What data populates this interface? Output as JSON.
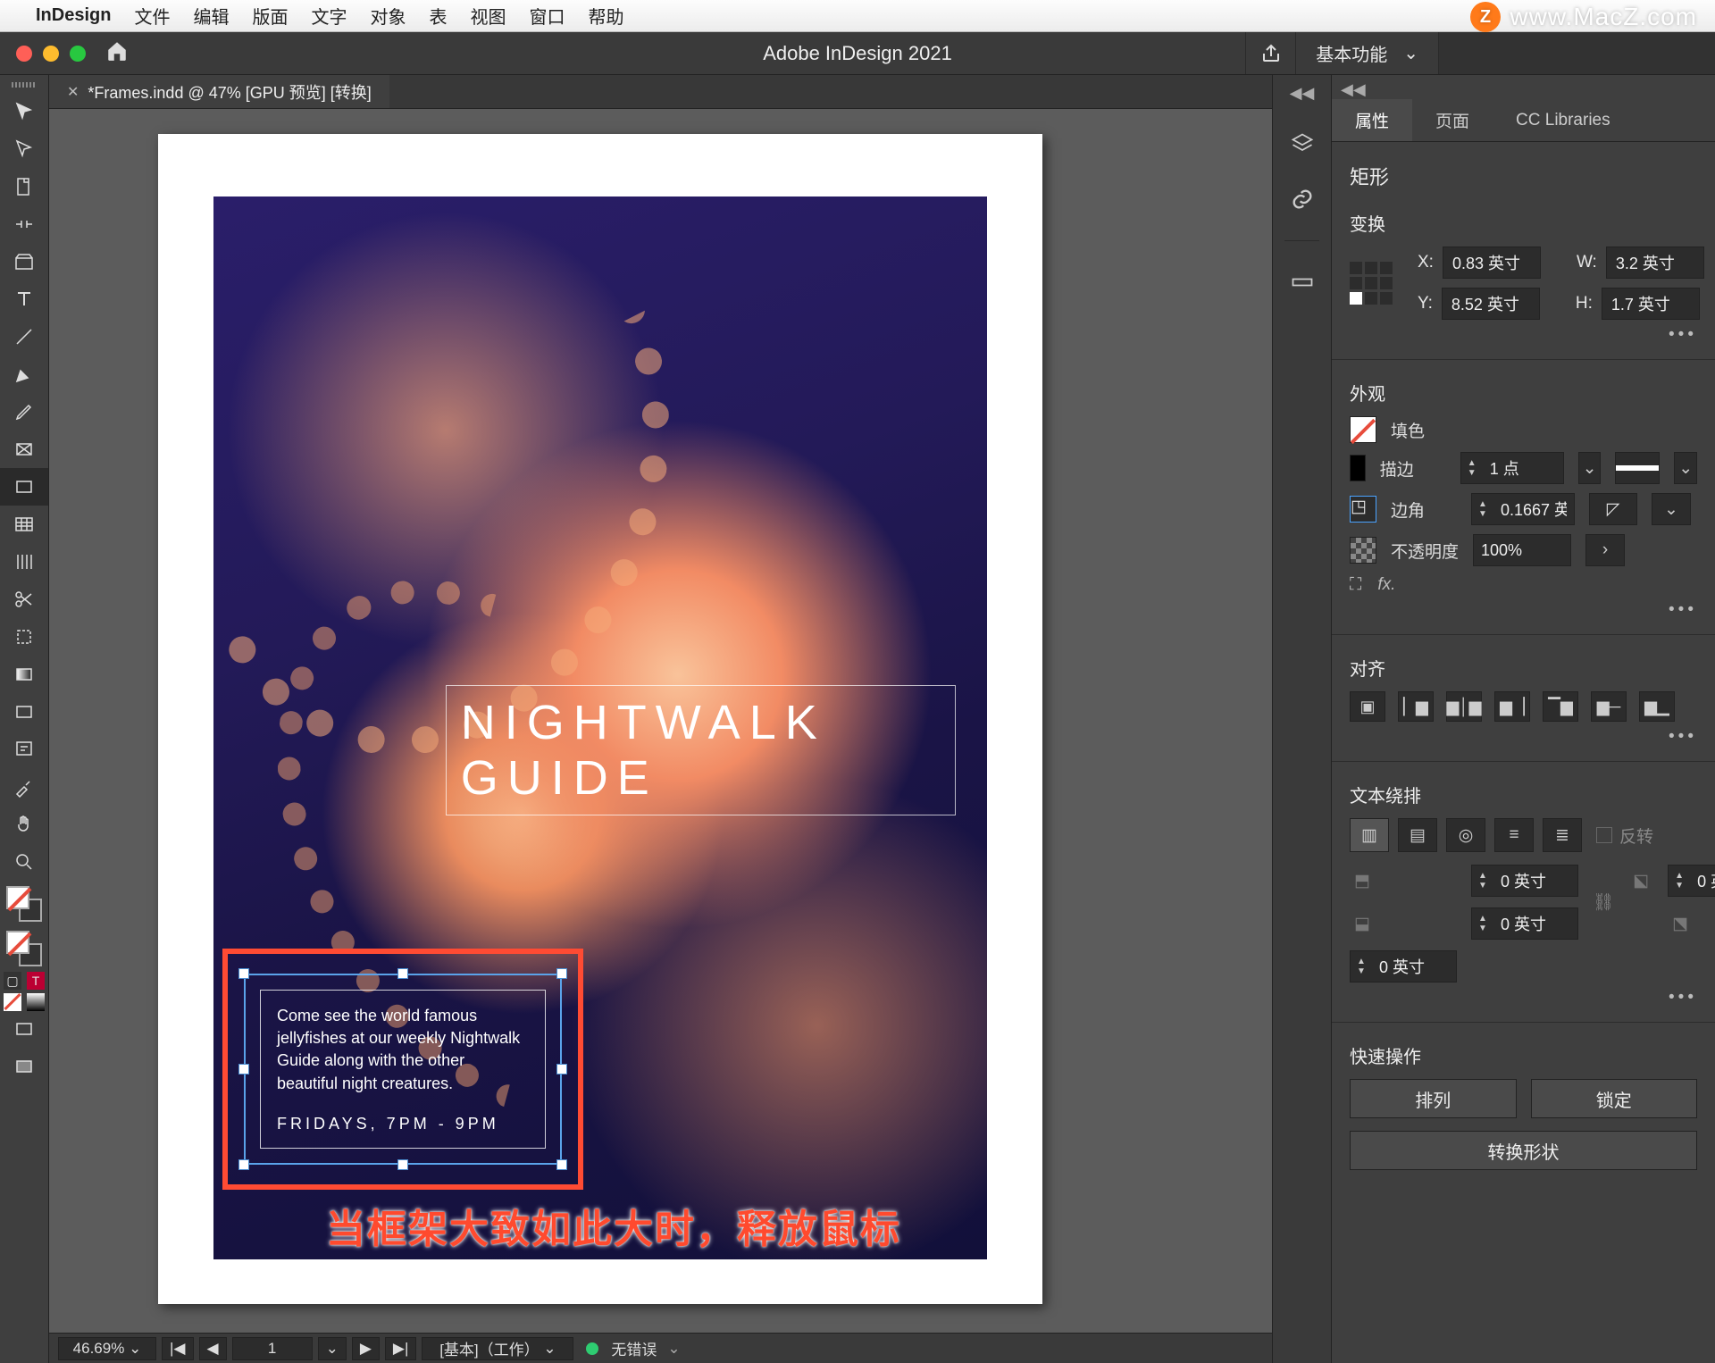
{
  "menubar": {
    "app": "InDesign",
    "items": [
      "文件",
      "编辑",
      "版面",
      "文字",
      "对象",
      "表",
      "视图",
      "窗口",
      "帮助"
    ]
  },
  "watermark": {
    "letter": "Z",
    "url": "www.MacZ.com"
  },
  "titlebar": {
    "title": "Adobe InDesign 2021",
    "workspace": "基本功能"
  },
  "document_tab": {
    "label": "*Frames.indd @ 47% [GPU 预览] [转换]"
  },
  "artwork": {
    "hero_title": "NIGHTWALK GUIDE",
    "body": "Come see the world famous jellyfishes at our weekly Nightwalk Guide along with the other beautiful night creatures.",
    "schedule": "FRIDAYS, 7PM - 9PM"
  },
  "caption": "当框架大致如此大时，释放鼠标",
  "panels": {
    "tabs": [
      "属性",
      "页面",
      "CC Libraries"
    ],
    "object_type": "矩形",
    "transform": {
      "label": "变换",
      "x_label": "X:",
      "x": "0.83 英寸",
      "y_label": "Y:",
      "y": "8.52 英寸",
      "w_label": "W:",
      "w": "3.2 英寸",
      "h_label": "H:",
      "h": "1.7 英寸"
    },
    "appearance": {
      "label": "外观",
      "fill_label": "填色",
      "stroke_label": "描边",
      "stroke_weight": "1 点",
      "corner_label": "边角",
      "corner_value": "0.1667 英",
      "opacity_label": "不透明度",
      "opacity_value": "100%"
    },
    "align": {
      "label": "对齐"
    },
    "text_wrap": {
      "label": "文本绕排",
      "invert": "反转",
      "offset_value": "0 英寸"
    },
    "quick": {
      "label": "快速操作",
      "arrange": "排列",
      "lock": "锁定",
      "convert": "转换形状"
    }
  },
  "statusbar": {
    "zoom": "46.69%",
    "page": "1",
    "layer": "[基本]（工作）",
    "errors": "无错误"
  }
}
